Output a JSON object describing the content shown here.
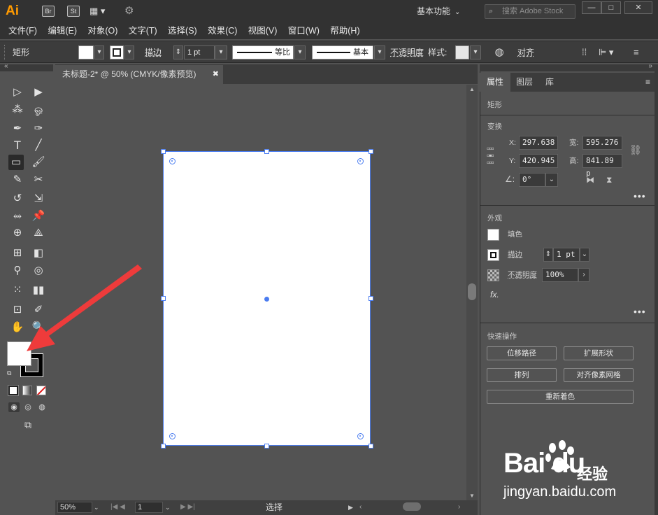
{
  "titlebar": {
    "logo": "Ai",
    "bridge": "Br",
    "stock": "St",
    "workspace": "基本功能",
    "search_placeholder": "搜索 Adobe Stock",
    "min": "—",
    "max": "□",
    "close": "✕"
  },
  "menu": [
    "文件(F)",
    "编辑(E)",
    "对象(O)",
    "文字(T)",
    "选择(S)",
    "效果(C)",
    "视图(V)",
    "窗口(W)",
    "帮助(H)"
  ],
  "controlbar": {
    "object_type": "矩形",
    "stroke_label": "描边",
    "stroke_value": "1 pt",
    "profile_label": "等比",
    "brush_label": "基本",
    "opacity_label": "不透明度",
    "style_label": "样式",
    "align_label": "对齐"
  },
  "document": {
    "tab_title": "未标题-2* @ 50% (CMYK/像素预览)",
    "zoom": "50%",
    "page": "1",
    "status": "选择"
  },
  "panel": {
    "tabs": [
      "属性",
      "图层",
      "库"
    ],
    "object_type": "矩形",
    "transform_label": "变换",
    "x_label": "X:",
    "x_value": "297.638",
    "y_label": "Y:",
    "y_value": "420.945",
    "w_label": "宽:",
    "w_value": "595.276",
    "h_label": "高:",
    "h_value": "841.89 p",
    "angle_value": "0°",
    "appearance_label": "外观",
    "fill_label": "填色",
    "stroke_label": "描边",
    "stroke_value": "1 pt",
    "opacity_label": "不透明度",
    "opacity_value": "100%",
    "fx_label": "fx.",
    "quick_actions_label": "快速操作",
    "btn_offset_path": "位移路径",
    "btn_expand_shape": "扩展形状",
    "btn_arrange": "排列",
    "btn_align_pixel": "对齐像素网格",
    "btn_recolor": "重新着色"
  },
  "watermark": {
    "logo": "Bai du",
    "jingyan": "经验",
    "url": "jingyan.baidu.com"
  },
  "colors": {
    "accent": "#4a7cf0",
    "arrow": "#ee3b3b",
    "logo": "#FF9A00"
  }
}
